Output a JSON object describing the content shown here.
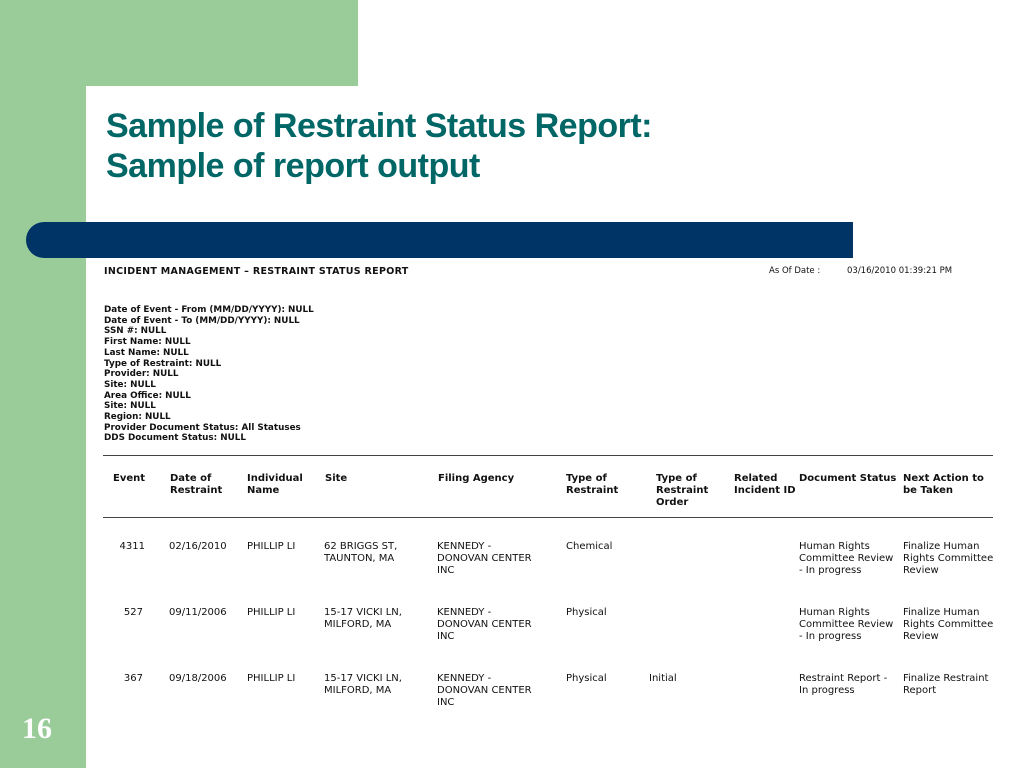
{
  "slide": {
    "title_line1": "Sample of Restraint Status Report:",
    "title_line2": "Sample of report output",
    "page_number": "16"
  },
  "report": {
    "title": "INCIDENT MANAGEMENT – RESTRAINT STATUS REPORT",
    "as_of_label": "As Of Date :",
    "as_of_value": "03/16/2010 01:39:21 PM",
    "parameters": [
      "Date of Event - From (MM/DD/YYYY): NULL",
      "Date of Event - To (MM/DD/YYYY): NULL",
      "SSN #: NULL",
      "First Name: NULL",
      "Last Name: NULL",
      "Type of Restraint: NULL",
      "Provider: NULL",
      "Site: NULL",
      "Area Office: NULL",
      "Site: NULL",
      "Region: NULL",
      "Provider Document Status: All Statuses",
      "DDS Document Status: NULL"
    ],
    "columns": {
      "event": "Event",
      "date_1": "Date of",
      "date_2": "Restraint",
      "individual_1": "Individual",
      "individual_2": "Name",
      "site": "Site",
      "filing": "Filing Agency",
      "type_1": "Type of",
      "type_2": "Restraint",
      "order_1": "Type of",
      "order_2": "Restraint",
      "order_3": "Order",
      "related_1": "Related",
      "related_2": "Incident ID",
      "docstatus": "Document Status",
      "next_1": "Next Action to",
      "next_2": "be Taken"
    },
    "rows": [
      {
        "event": "4311",
        "date": "02/16/2010",
        "name": "PHILLIP LI",
        "site_1": "62 BRIGGS ST,",
        "site_2": "TAUNTON, MA",
        "agency_1": "KENNEDY -",
        "agency_2": "DONOVAN CENTER",
        "agency_3": "INC",
        "type": "Chemical",
        "order": "",
        "related": "",
        "status_1": "Human Rights",
        "status_2": "Committee Review",
        "status_3": "- In progress",
        "next_1": "Finalize Human",
        "next_2": "Rights Committee",
        "next_3": "Review"
      },
      {
        "event": "527",
        "date": "09/11/2006",
        "name": "PHILLIP LI",
        "site_1": "15-17 VICKI LN,",
        "site_2": "MILFORD, MA",
        "agency_1": "KENNEDY -",
        "agency_2": "DONOVAN CENTER",
        "agency_3": "INC",
        "type": "Physical",
        "order": "",
        "related": "",
        "status_1": "Human Rights",
        "status_2": "Committee Review",
        "status_3": "- In progress",
        "next_1": "Finalize Human",
        "next_2": "Rights Committee",
        "next_3": "Review"
      },
      {
        "event": "367",
        "date": "09/18/2006",
        "name": "PHILLIP LI",
        "site_1": "15-17 VICKI LN,",
        "site_2": "MILFORD, MA",
        "agency_1": "KENNEDY -",
        "agency_2": "DONOVAN CENTER",
        "agency_3": "INC",
        "type": "Physical",
        "order": "Initial",
        "related": "",
        "status_1": "Restraint Report -",
        "status_2": "In progress",
        "status_3": "",
        "next_1": "Finalize Restraint",
        "next_2": "Report",
        "next_3": ""
      }
    ]
  },
  "colors": {
    "green": "#99cc99",
    "title_teal": "#006666",
    "bar_navy": "#003366"
  }
}
